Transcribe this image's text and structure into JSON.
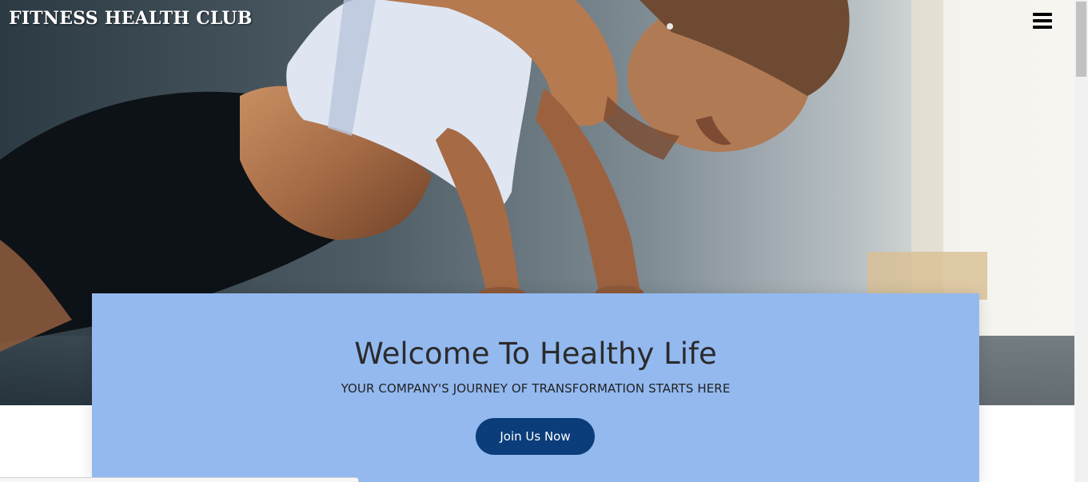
{
  "header": {
    "brand": "FITNESS HEALTH CLUB",
    "menu_icon": "hamburger-menu-icon"
  },
  "hero": {
    "image_description_icon": "woman-doing-plank-photo"
  },
  "welcome": {
    "title": "Welcome To Healthy Life",
    "subtitle": "YOUR COMPANY'S JOURNEY OF TRANSFORMATION STARTS HERE",
    "cta_label": "Join Us Now"
  },
  "colors": {
    "card_background": "#93b9ef",
    "cta_background": "#0b3d7a",
    "cta_text": "#ffffff",
    "brand_text": "#ffffff"
  }
}
